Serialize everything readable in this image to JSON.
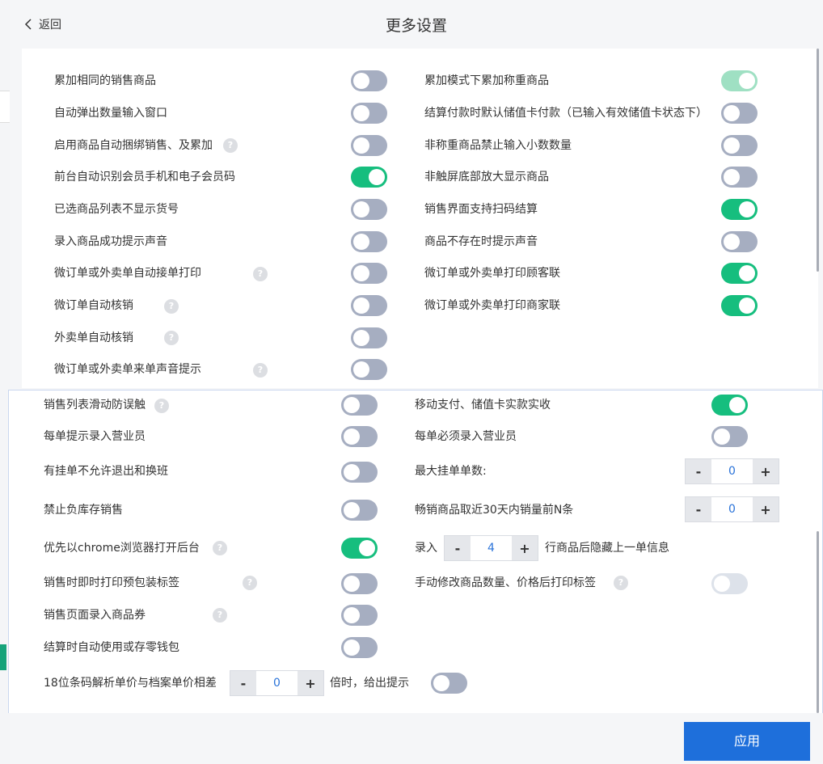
{
  "header": {
    "back_label": "返回",
    "title": "更多设置"
  },
  "help_mark": "?",
  "top_left": [
    {
      "label": "累加相同的销售商品",
      "state": "off"
    },
    {
      "label": "自动弹出数量输入窗口",
      "state": "off"
    },
    {
      "label": "启用商品自动捆绑销售、及累加",
      "state": "off",
      "help": true
    },
    {
      "label": "前台自动识别会员手机和电子会员码",
      "state": "on"
    },
    {
      "label": "已选商品列表不显示货号",
      "state": "off"
    },
    {
      "label": "录入商品成功提示声音",
      "state": "off"
    },
    {
      "label": "微订单或外卖单自动接单打印",
      "state": "off",
      "help": true
    },
    {
      "label": "微订单自动核销",
      "state": "off",
      "help": true
    },
    {
      "label": "外卖单自动核销",
      "state": "off",
      "help": true
    },
    {
      "label": "微订单或外卖单来单声音提示",
      "state": "off",
      "help": true
    }
  ],
  "top_right": [
    {
      "label": "累加模式下累加称重商品",
      "state": "on-disabled"
    },
    {
      "label": "结算付款时默认储值卡付款（已输入有效储值卡状态下）",
      "state": "off"
    },
    {
      "label": "非称重商品禁止输入小数数量",
      "state": "off"
    },
    {
      "label": "非触屏底部放大显示商品",
      "state": "off"
    },
    {
      "label": "销售界面支持扫码结算",
      "state": "on"
    },
    {
      "label": "商品不存在时提示声音",
      "state": "off"
    },
    {
      "label": "微订单或外卖单打印顾客联",
      "state": "on"
    },
    {
      "label": "微订单或外卖单打印商家联",
      "state": "on"
    }
  ],
  "bottom_left": [
    {
      "label": "销售列表滑动防误触",
      "state": "off",
      "help": true
    },
    {
      "label": "每单提示录入营业员",
      "state": "off"
    },
    {
      "label": "有挂单不允许退出和换班",
      "state": "off"
    },
    {
      "label": "禁止负库存销售",
      "state": "off"
    },
    {
      "label": "优先以chrome浏览器打开后台",
      "state": "on",
      "help": true
    },
    {
      "label": "销售时即时打印预包装标签",
      "state": "off",
      "help": true
    },
    {
      "label": "销售页面录入商品券",
      "state": "off",
      "help": true
    },
    {
      "label": "结算时自动使用或存零钱包",
      "state": "off"
    }
  ],
  "bottom_right": {
    "mobile_pay": {
      "label": "移动支付、储值卡实款实收",
      "state": "on"
    },
    "must_clerk": {
      "label": "每单必须录入营业员",
      "state": "off"
    },
    "max_hold": {
      "label": "最大挂单单数:",
      "value": "0"
    },
    "best_sellers": {
      "label": "畅销商品取近30天内销量前N条",
      "value": "0"
    },
    "hide_prev": {
      "prefix": "录入",
      "value": "4",
      "suffix": "行商品后隐藏上一单信息"
    },
    "print_label": {
      "label": "手动修改商品数量、价格后打印标签",
      "state": "off-disabled",
      "help": true
    }
  },
  "barcode_row": {
    "prefix": "18位条码解析单价与档案单价相差",
    "value": "0",
    "suffix": "倍时，给出提示",
    "state": "off"
  },
  "stepper": {
    "minus": "-",
    "plus": "+"
  },
  "footer": {
    "apply_label": "应用"
  },
  "colors": {
    "toggle_on": "#16be7e",
    "toggle_off": "#a6aec1",
    "primary": "#1e6fdb"
  }
}
